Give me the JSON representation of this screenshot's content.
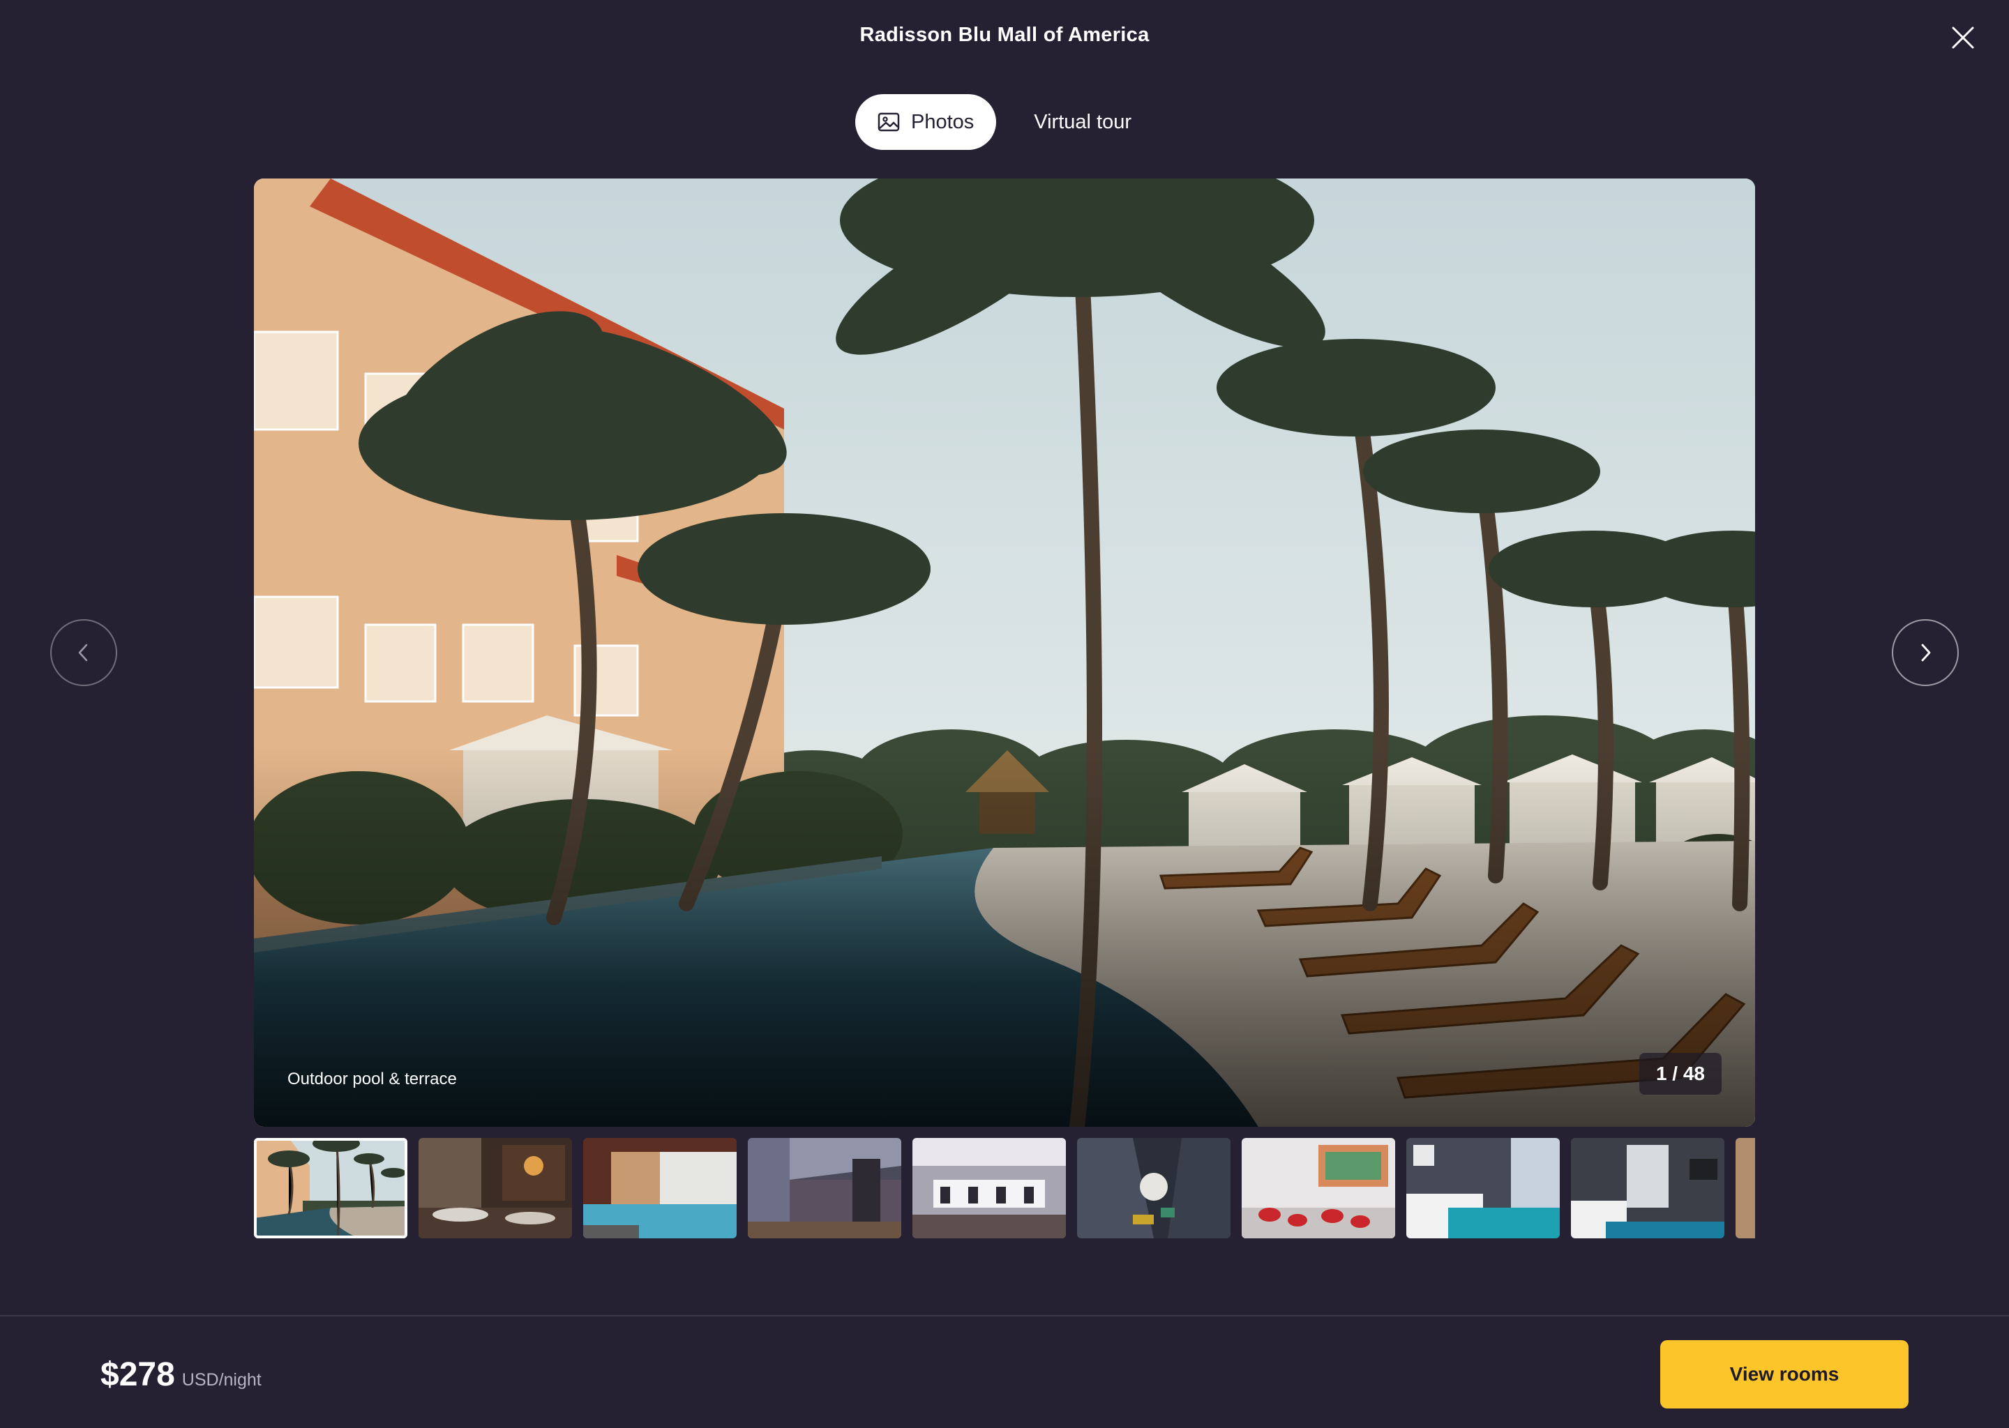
{
  "header": {
    "title": "Radisson Blu Mall of America",
    "close_icon": "close-icon"
  },
  "tabs": [
    {
      "label": "Photos",
      "icon": "image-icon",
      "active": true
    },
    {
      "label": "Virtual tour",
      "active": false
    }
  ],
  "photo": {
    "caption": "Outdoor pool & terrace",
    "counter": "1 / 48"
  },
  "thumbnails": [
    {
      "subject": "pool",
      "selected": true
    },
    {
      "subject": "restaurant"
    },
    {
      "subject": "indoor-pool"
    },
    {
      "subject": "lobby"
    },
    {
      "subject": "bar"
    },
    {
      "subject": "atrium"
    },
    {
      "subject": "lounge"
    },
    {
      "subject": "bedroom"
    },
    {
      "subject": "suite"
    },
    {
      "subject": "partial"
    }
  ],
  "footer": {
    "price": "$278",
    "price_unit": "USD/night",
    "cta_label": "View rooms"
  },
  "colors": {
    "background": "#262033",
    "accent": "#fcc52a",
    "text": "#ffffff",
    "muted": "#b9b4c4"
  }
}
